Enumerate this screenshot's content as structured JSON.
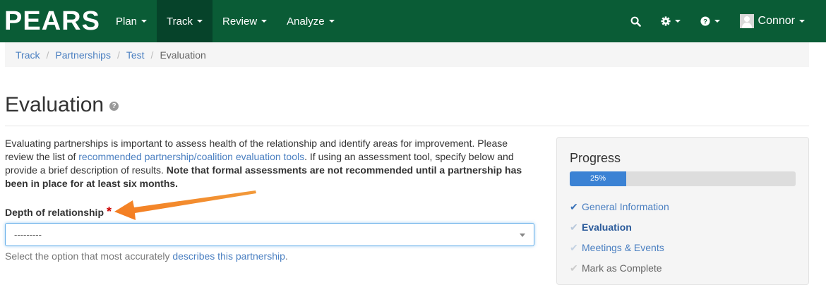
{
  "navbar": {
    "brand": "PEARS",
    "items": [
      {
        "label": "Plan",
        "active": false
      },
      {
        "label": "Track",
        "active": true
      },
      {
        "label": "Review",
        "active": false
      },
      {
        "label": "Analyze",
        "active": false
      }
    ],
    "user_name": "Connor",
    "icons": [
      "search-icon",
      "gear-icon",
      "question-circle-icon",
      "user-avatar"
    ],
    "colors": {
      "bar": "#0a5c36",
      "active": "#06432a"
    }
  },
  "breadcrumb": {
    "items": [
      "Track",
      "Partnerships",
      "Test"
    ],
    "current": "Evaluation"
  },
  "page": {
    "title": "Evaluation",
    "intro_part1": "Evaluating partnerships is important to assess health of the relationship and identify areas for improvement. Please review the list of ",
    "intro_link": "recommended partnership/coalition evaluation tools",
    "intro_part2": ". If using an assessment tool, specify below and provide a brief description of results. ",
    "intro_bold": "Note that formal assessments are not recommended until a partnership has been in place for at least six months."
  },
  "field": {
    "label": "Depth of relationship",
    "required_marker": "*",
    "select_value": "---------",
    "help_prefix": "Select the option that most accurately ",
    "help_link": "describes this partnership",
    "help_suffix": "."
  },
  "progress": {
    "title": "Progress",
    "percent_label": "25%",
    "percent": 25,
    "steps": [
      {
        "label": "General Information",
        "state": "done"
      },
      {
        "label": "Evaluation",
        "state": "current"
      },
      {
        "label": "Meetings & Events",
        "state": "todo"
      },
      {
        "label": "Mark as Complete",
        "state": "disabled"
      }
    ]
  }
}
